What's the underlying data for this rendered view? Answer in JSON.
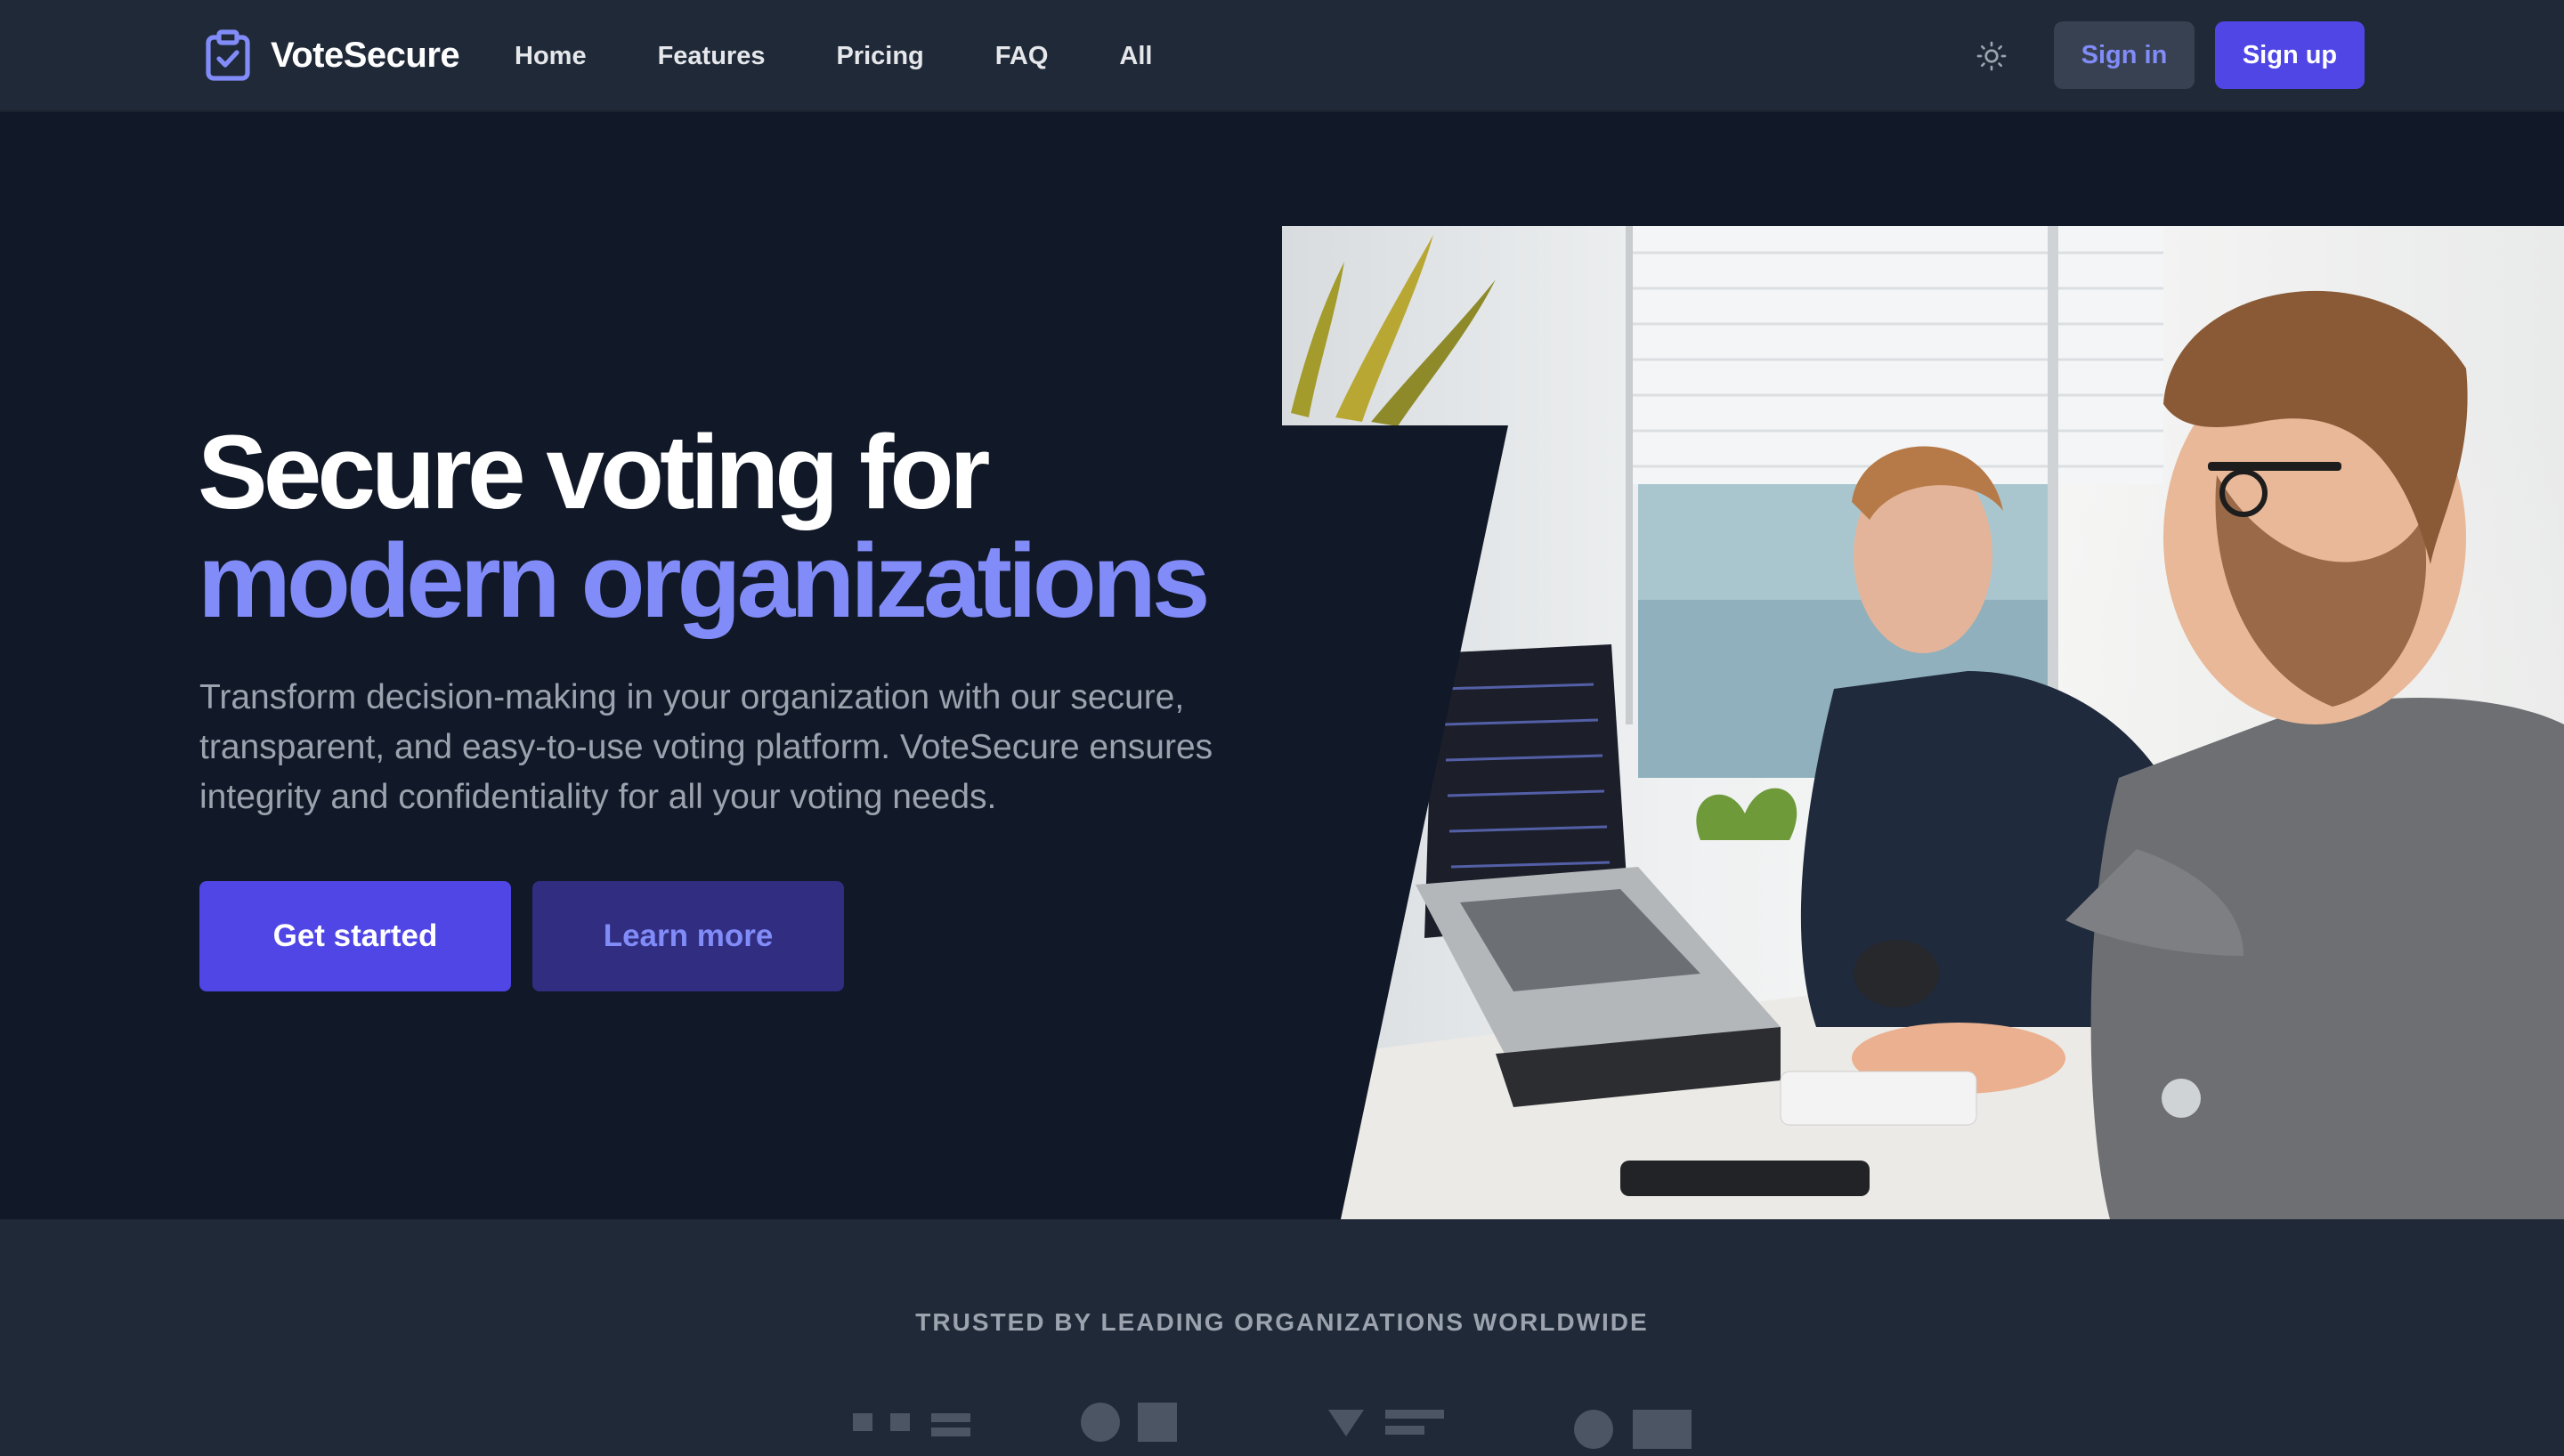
{
  "nav": {
    "brand": "VoteSecure",
    "links": [
      "Home",
      "Features",
      "Pricing",
      "FAQ",
      "All"
    ],
    "theme_icon": "sun-icon",
    "signin_label": "Sign in",
    "signup_label": "Sign up"
  },
  "hero": {
    "headline_line1": "Secure voting for",
    "headline_line2": "modern organizations",
    "description": "Transform decision-making in your organization with our secure, transparent, and easy-to-use voting platform. VoteSecure ensures integrity and confidentiality for all your voting needs.",
    "primary_cta": "Get started",
    "secondary_cta": "Learn more"
  },
  "trusted": {
    "title": "TRUSTED BY LEADING ORGANIZATIONS WORLDWIDE"
  },
  "colors": {
    "page_bg": "#111827",
    "nav_bg": "#1f2937",
    "accent": "#4f46e5",
    "accent_text": "#818cf8",
    "secondary_button_bg": "#312e81"
  }
}
